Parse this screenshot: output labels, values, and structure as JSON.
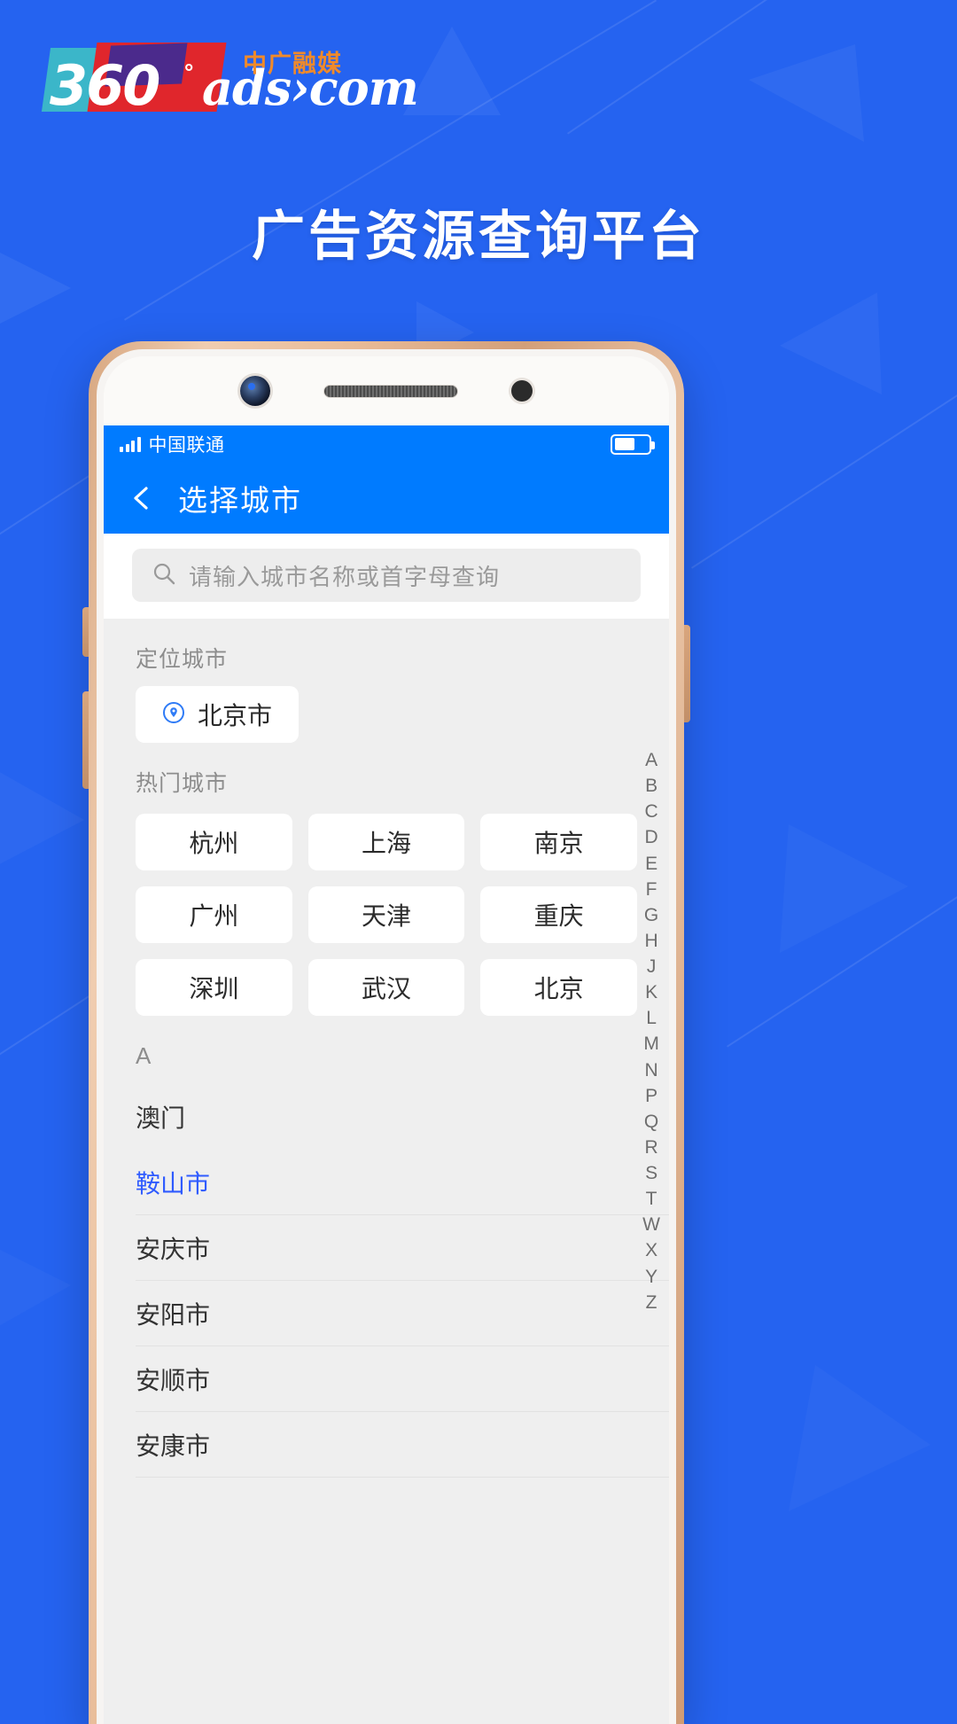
{
  "brand": {
    "logo_number": "360",
    "logo_degree": "°",
    "logo_domain": "ads›com",
    "logo_cn": "中广融媒"
  },
  "headline": "广告资源查询平台",
  "phone": {
    "status_bar": {
      "carrier": "中国联通",
      "signal_icon": "signal-bars-icon",
      "battery_icon": "battery-icon"
    },
    "navbar": {
      "back_icon": "back-chevron-icon",
      "title": "选择城市"
    },
    "search": {
      "icon": "search-icon",
      "placeholder": "请输入城市名称或首字母查询",
      "value": ""
    },
    "located": {
      "label": "定位城市",
      "pin_icon": "location-pin-icon",
      "city": "北京市"
    },
    "hot": {
      "label": "热门城市",
      "cities": [
        "杭州",
        "上海",
        "南京",
        "广州",
        "天津",
        "重庆",
        "深圳",
        "武汉",
        "北京"
      ]
    },
    "alpha_section": {
      "letter": "A",
      "cities": [
        {
          "name": "澳门",
          "active": false
        },
        {
          "name": "鞍山市",
          "active": true
        },
        {
          "name": "安庆市",
          "active": false
        },
        {
          "name": "安阳市",
          "active": false
        },
        {
          "name": "安顺市",
          "active": false
        },
        {
          "name": "安康市",
          "active": false
        }
      ]
    },
    "index_rail": [
      "A",
      "B",
      "C",
      "D",
      "E",
      "F",
      "G",
      "H",
      "J",
      "K",
      "L",
      "M",
      "N",
      "P",
      "Q",
      "R",
      "S",
      "T",
      "W",
      "X",
      "Y",
      "Z"
    ]
  },
  "colors": {
    "page_bg": "#2563f0",
    "app_blue": "#007bff",
    "accent_orange": "#f08a2a",
    "active_city": "#2f5bff"
  }
}
